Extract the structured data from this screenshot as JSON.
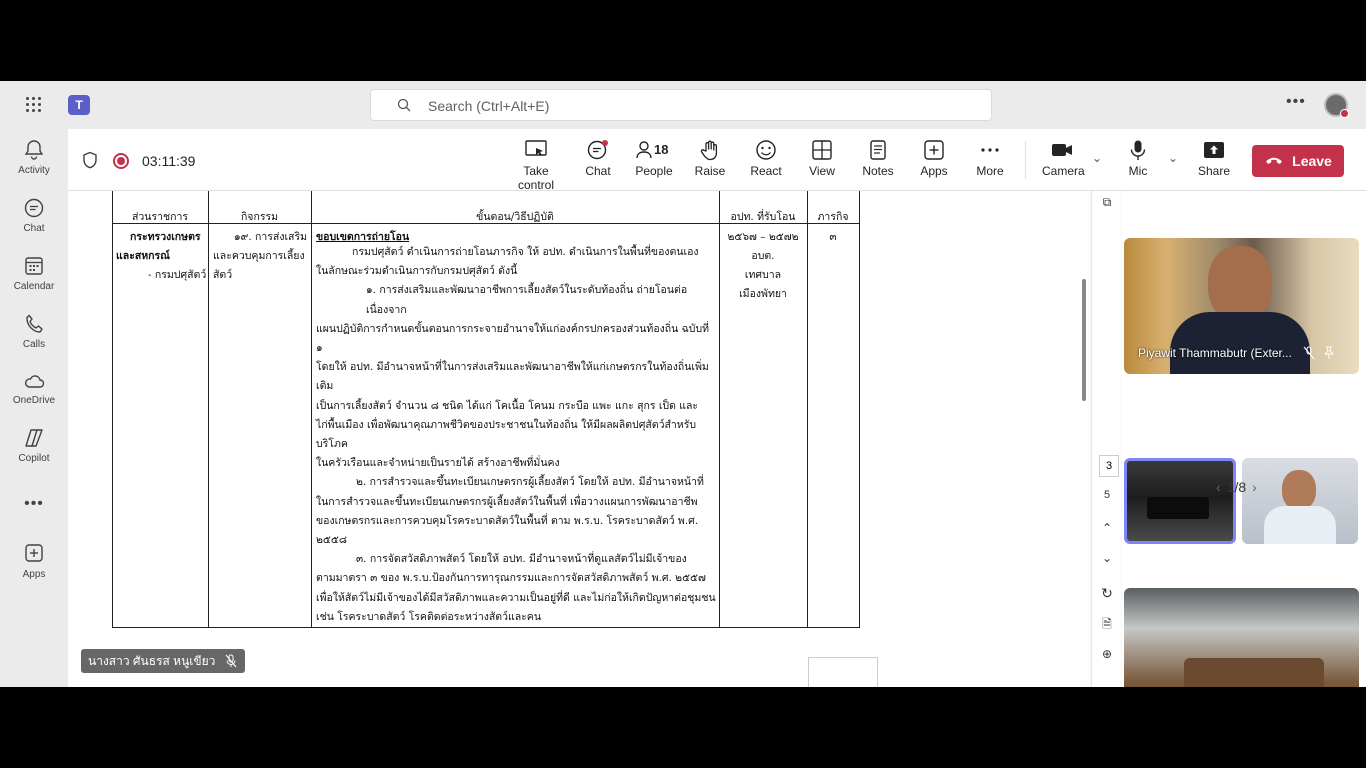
{
  "topbar": {
    "search_placeholder": "Search (Ctrl+Alt+E)"
  },
  "rail": {
    "items": [
      {
        "label": "Activity",
        "icon": "bell-icon"
      },
      {
        "label": "Chat",
        "icon": "chat-icon"
      },
      {
        "label": "Calendar",
        "icon": "calendar-icon"
      },
      {
        "label": "Calls",
        "icon": "phone-icon"
      },
      {
        "label": "OneDrive",
        "icon": "cloud-icon"
      },
      {
        "label": "Copilot",
        "icon": "copilot-icon"
      },
      {
        "label": "Apps",
        "icon": "plus-box-icon"
      }
    ]
  },
  "meeting": {
    "timer": "03:11:39",
    "toolbar": {
      "take_control": "Take control",
      "chat": "Chat",
      "people_count": "18",
      "people": "People",
      "raise": "Raise",
      "react": "React",
      "view": "View",
      "notes": "Notes",
      "apps": "Apps",
      "more": "More",
      "camera": "Camera",
      "mic": "Mic",
      "share": "Share",
      "leave": "Leave"
    }
  },
  "document": {
    "header": {
      "col1": "ส่วนราชการ",
      "col2": "กิจกรรม",
      "col3": "ขั้นตอน/วิธีปฏิบัติ",
      "col4": "อปท. ที่รับโอน",
      "col5": "ภารกิจ"
    },
    "row": {
      "agency_1": "กระทรวงเกษตร",
      "agency_2": "และสหกรณ์",
      "agency_3": "- กรมปศุสัตว์",
      "activity_1": "๑๙. การส่งเสริม",
      "activity_2": "และควบคุมการเลี้ยง",
      "activity_3": "สัตว์",
      "scope_title": "ขอบเขตการถ่ายโอน",
      "lines": [
        "กรมปศุสัตว์ ดำเนินการถ่ายโอนภารกิจ ให้ อปท. ดำเนินการในพื้นที่ของตนเอง",
        "ในลักษณะร่วมดำเนินการกับกรมปศุสัตว์ ดังนี้",
        "๑. การส่งเสริมและพัฒนาอาชีพการเลี้ยงสัตว์ในระดับท้องถิ่น ถ่ายโอนต่อเนื่องจาก",
        "แผนปฏิบัติการกำหนดขั้นตอนการกระจายอำนาจให้แก่องค์กรปกครองส่วนท้องถิ่น ฉบับที่ ๑",
        "โดยให้ อปท. มีอำนาจหน้าที่ในการส่งเสริมและพัฒนาอาชีพให้แก่เกษตรกรในท้องถิ่นเพิ่มเติม",
        "เป็นการเลี้ยงสัตว์ จำนวน ๘ ชนิด ได้แก่ โคเนื้อ โคนม กระบือ แพะ แกะ สุกร เป็ด และ",
        "ไก่พื้นเมือง เพื่อพัฒนาคุณภาพชีวิตของประชาชนในท้องถิ่น ให้มีผลผลิตปศุสัตว์สำหรับบริโภค",
        "ในครัวเรือนและจำหน่ายเป็นรายได้ สร้างอาชีพที่มั่นคง",
        "๒. การสำรวจและขึ้นทะเบียนเกษตรกรผู้เลี้ยงสัตว์ โดยให้ อปท. มีอำนาจหน้าที่",
        "ในการสำรวจและขึ้นทะเบียนเกษตรกรผู้เลี้ยงสัตว์ในพื้นที่ เพื่อวางแผนการพัฒนาอาชีพ",
        "ของเกษตรกรและการควบคุมโรคระบาดสัตว์ในพื้นที่ ตาม พ.ร.บ. โรคระบาดสัตว์ พ.ศ. ๒๕๕๘",
        "๓. การจัดสวัสดิภาพสัตว์ โดยให้ อปท. มีอำนาจหน้าที่ดูแลสัตว์ไม่มีเจ้าของ",
        "ตามมาตรา ๓ ของ พ.ร.บ.ป้องกันการทารุณกรรมและการจัดสวัสดิภาพสัตว์ พ.ศ. ๒๕๕๗",
        "เพื่อให้สัตว์ไม่มีเจ้าของได้มีสวัสดิภาพและความเป็นอยู่ที่ดี และไม่ก่อให้เกิดปัญหาต่อชุมชน",
        "เช่น โรคระบาดสัตว์ โรคติดต่อระหว่างสัตว์และคน"
      ],
      "years": "๒๕๖๗ – ๒๕๗๒",
      "receiver_1": "อบต.",
      "receiver_2": "เทศบาล",
      "receiver_3": "เมืองพัทยา",
      "mission": "๓"
    }
  },
  "presenter_name": "นางสาว ศันธรส หนูเขียว",
  "pdf_tools": {
    "page_current": "3",
    "page_next": "5"
  },
  "videos": {
    "main_name": "Piyawit Thammabutr (Exter...",
    "pager": "1/8"
  }
}
